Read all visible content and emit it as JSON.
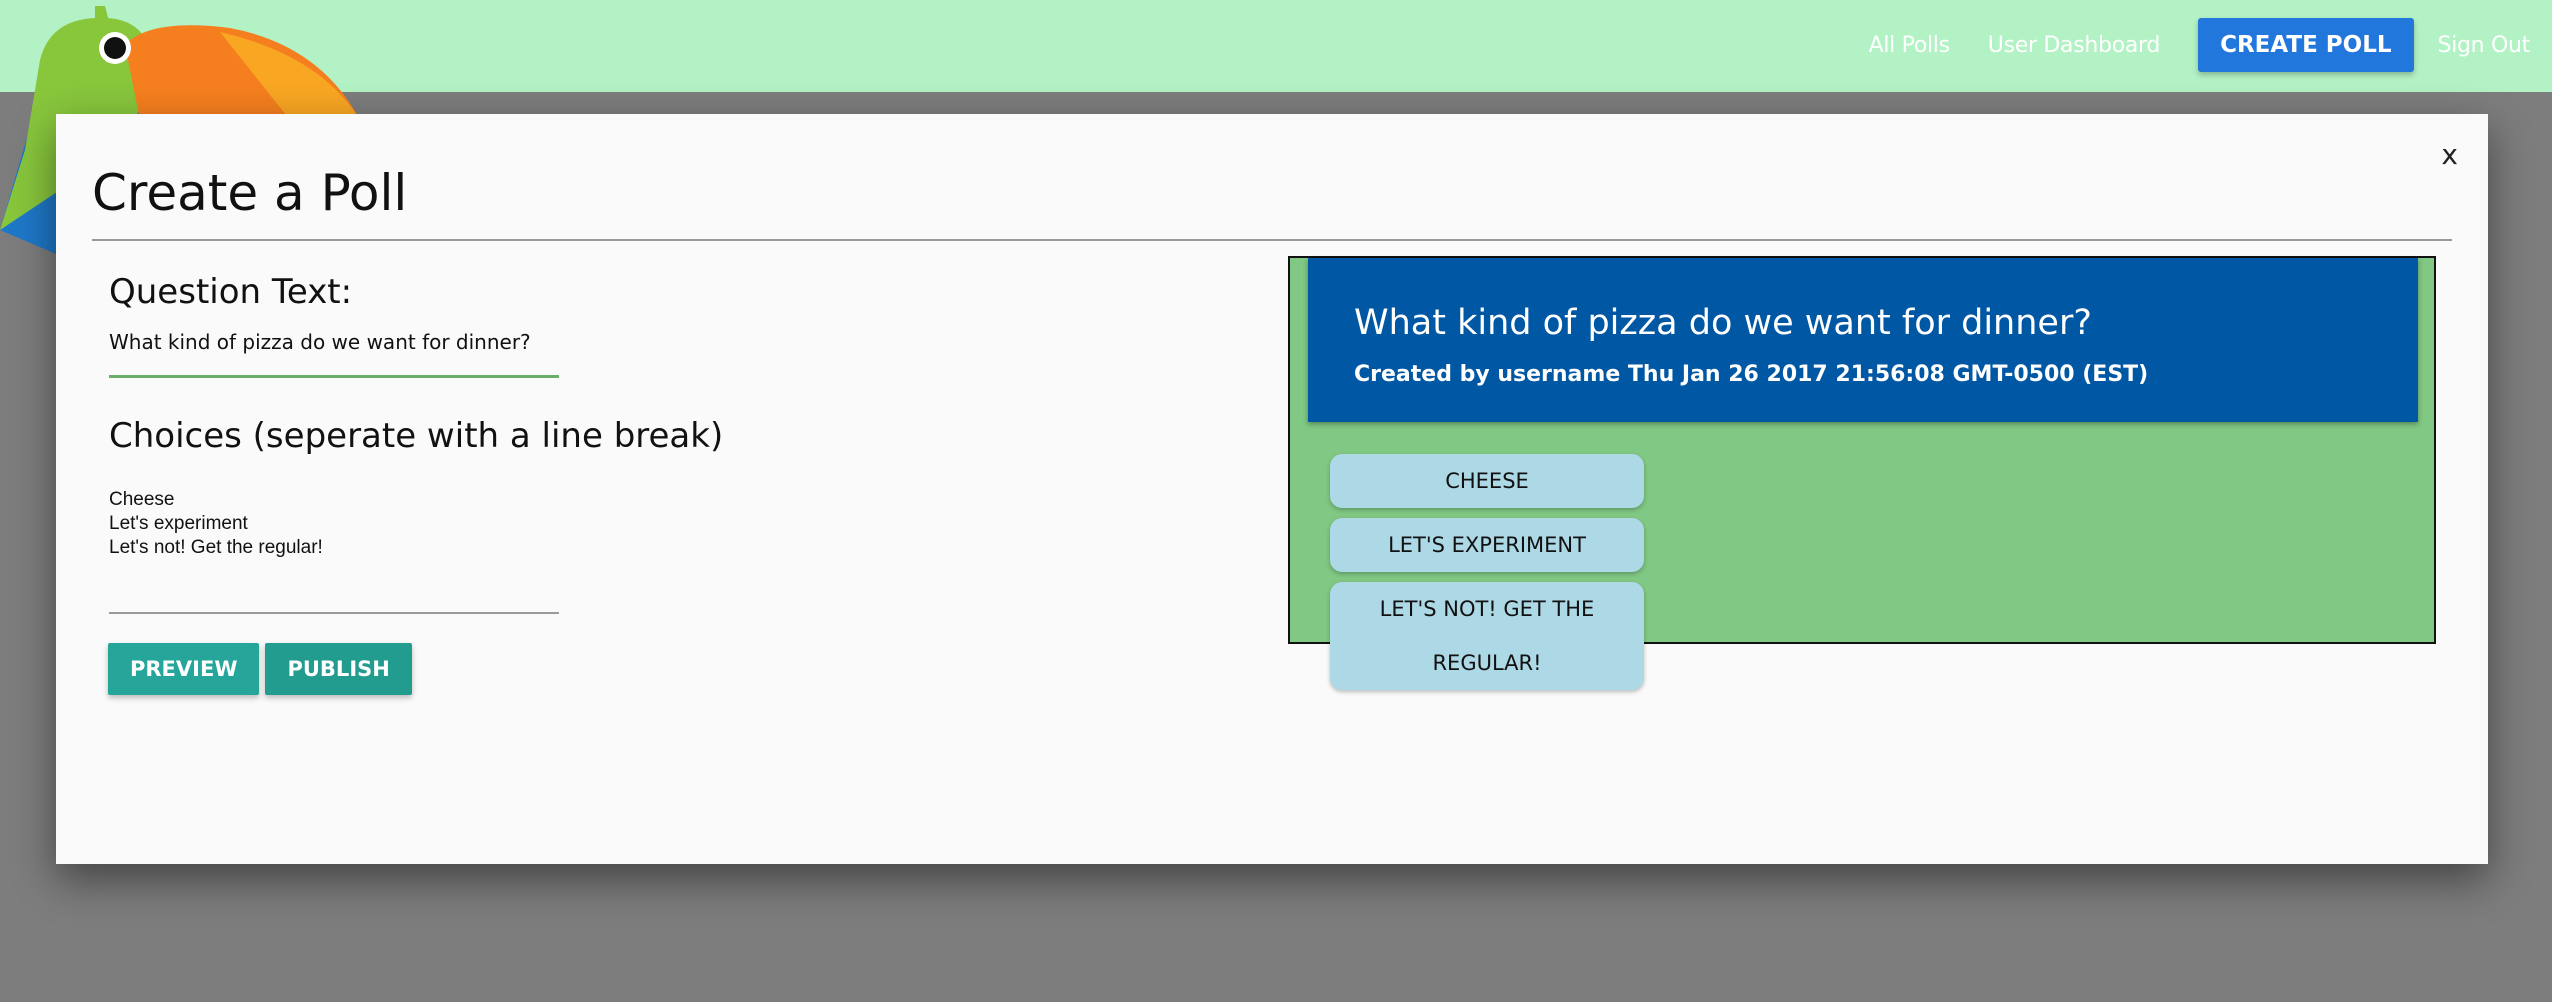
{
  "nav": {
    "all_polls": "All Polls",
    "user_dashboard": "User Dashboard",
    "create_poll": "CREATE POLL",
    "sign_out": "Sign Out"
  },
  "modal": {
    "title": "Create a Poll",
    "close": "x",
    "question_label": "Question Text:",
    "question_value": "What kind of pizza do we want for dinner?",
    "choices_label": "Choices (seperate with a line break)",
    "choices_value": "Cheese\nLet's experiment\nLet's not! Get the regular!",
    "preview_button": "PREVIEW",
    "publish_button": "PUBLISH"
  },
  "preview": {
    "question": "What kind of pizza do we want for dinner?",
    "meta": "Created by username Thu Jan 26 2017 21:56:08 GMT-0500 (EST)",
    "choices": [
      "CHEESE",
      "LET'S EXPERIMENT",
      "LET'S NOT! GET THE REGULAR!"
    ]
  },
  "colors": {
    "navbar": "#b3f2c5",
    "create_btn": "#2277dd",
    "action_btn": "#26a69a",
    "preview_bg": "#80c883",
    "preview_header": "#0057a3",
    "choice_bg": "#add8e6"
  },
  "icons": {
    "logo": "toucan-logo-icon",
    "close": "close-icon"
  }
}
